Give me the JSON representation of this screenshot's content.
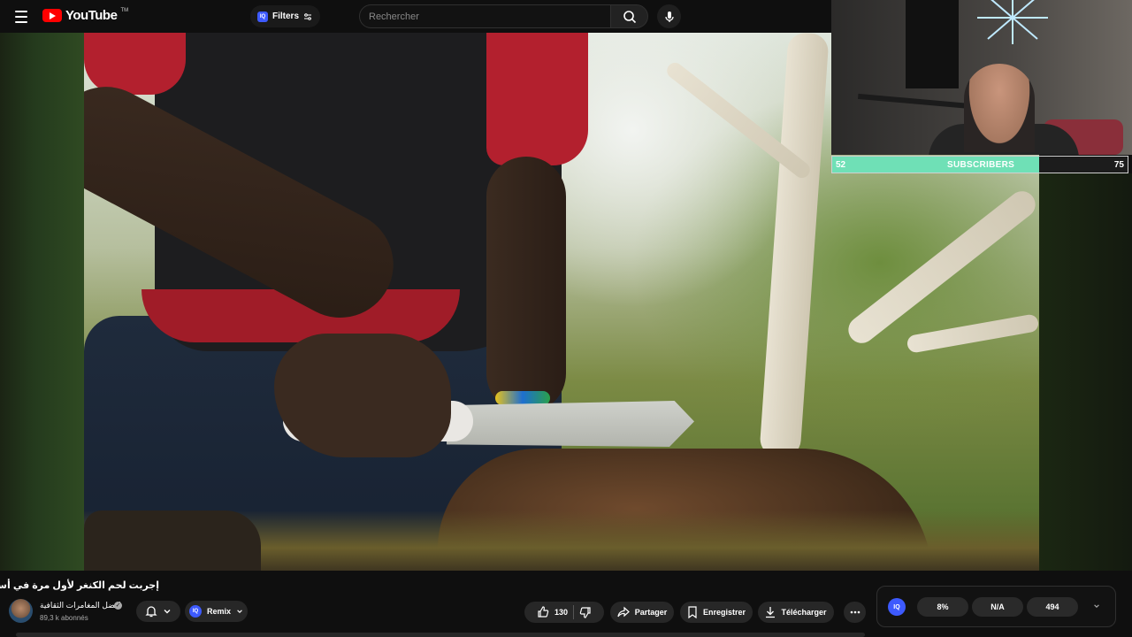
{
  "header": {
    "logo_text": "YouTube",
    "logo_tm": "TM",
    "filters_label": "Filters",
    "iq_badge": "IQ",
    "search_placeholder": "Rechercher"
  },
  "overlay": {
    "subscriber_goal": {
      "label": "SUBSCRIBERS",
      "min": "52",
      "max": "75",
      "progress": 0.7
    }
  },
  "video": {
    "title": "إجربت لحم الكنغر لأول مرة في أستراليا",
    "channel_name": "افضل المغامرات الثقافية",
    "subscribers": "89,3 k abonnés"
  },
  "actions": {
    "remix_label": "Remix",
    "like_count": "130",
    "share_label": "Partager",
    "save_label": "Enregistrer",
    "download_label": "Télécharger"
  },
  "iq_panel": {
    "logo": "IQ",
    "stat1": "8%",
    "stat2": "N/A",
    "stat3": "494"
  },
  "colors": {
    "brand": "#ff0000",
    "iq_blue": "#3d5afe",
    "goal_fill": "#6fe0b6"
  }
}
